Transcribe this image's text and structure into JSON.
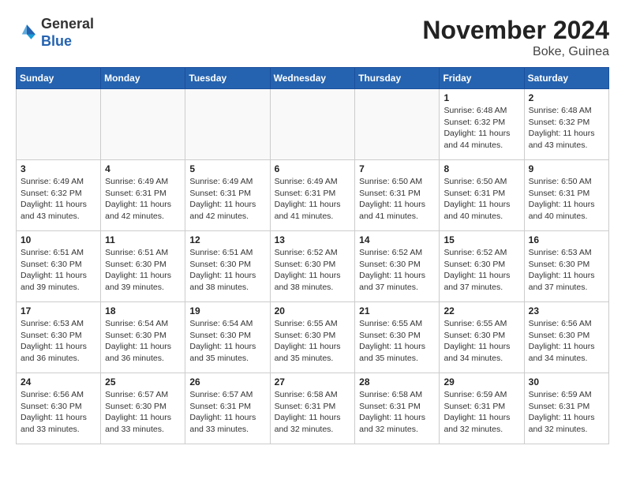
{
  "header": {
    "logo_general": "General",
    "logo_blue": "Blue",
    "month_year": "November 2024",
    "location": "Boke, Guinea"
  },
  "days_of_week": [
    "Sunday",
    "Monday",
    "Tuesday",
    "Wednesday",
    "Thursday",
    "Friday",
    "Saturday"
  ],
  "weeks": [
    [
      {
        "day": "",
        "info": ""
      },
      {
        "day": "",
        "info": ""
      },
      {
        "day": "",
        "info": ""
      },
      {
        "day": "",
        "info": ""
      },
      {
        "day": "",
        "info": ""
      },
      {
        "day": "1",
        "info": "Sunrise: 6:48 AM\nSunset: 6:32 PM\nDaylight: 11 hours and 44 minutes."
      },
      {
        "day": "2",
        "info": "Sunrise: 6:48 AM\nSunset: 6:32 PM\nDaylight: 11 hours and 43 minutes."
      }
    ],
    [
      {
        "day": "3",
        "info": "Sunrise: 6:49 AM\nSunset: 6:32 PM\nDaylight: 11 hours and 43 minutes."
      },
      {
        "day": "4",
        "info": "Sunrise: 6:49 AM\nSunset: 6:31 PM\nDaylight: 11 hours and 42 minutes."
      },
      {
        "day": "5",
        "info": "Sunrise: 6:49 AM\nSunset: 6:31 PM\nDaylight: 11 hours and 42 minutes."
      },
      {
        "day": "6",
        "info": "Sunrise: 6:49 AM\nSunset: 6:31 PM\nDaylight: 11 hours and 41 minutes."
      },
      {
        "day": "7",
        "info": "Sunrise: 6:50 AM\nSunset: 6:31 PM\nDaylight: 11 hours and 41 minutes."
      },
      {
        "day": "8",
        "info": "Sunrise: 6:50 AM\nSunset: 6:31 PM\nDaylight: 11 hours and 40 minutes."
      },
      {
        "day": "9",
        "info": "Sunrise: 6:50 AM\nSunset: 6:31 PM\nDaylight: 11 hours and 40 minutes."
      }
    ],
    [
      {
        "day": "10",
        "info": "Sunrise: 6:51 AM\nSunset: 6:30 PM\nDaylight: 11 hours and 39 minutes."
      },
      {
        "day": "11",
        "info": "Sunrise: 6:51 AM\nSunset: 6:30 PM\nDaylight: 11 hours and 39 minutes."
      },
      {
        "day": "12",
        "info": "Sunrise: 6:51 AM\nSunset: 6:30 PM\nDaylight: 11 hours and 38 minutes."
      },
      {
        "day": "13",
        "info": "Sunrise: 6:52 AM\nSunset: 6:30 PM\nDaylight: 11 hours and 38 minutes."
      },
      {
        "day": "14",
        "info": "Sunrise: 6:52 AM\nSunset: 6:30 PM\nDaylight: 11 hours and 37 minutes."
      },
      {
        "day": "15",
        "info": "Sunrise: 6:52 AM\nSunset: 6:30 PM\nDaylight: 11 hours and 37 minutes."
      },
      {
        "day": "16",
        "info": "Sunrise: 6:53 AM\nSunset: 6:30 PM\nDaylight: 11 hours and 37 minutes."
      }
    ],
    [
      {
        "day": "17",
        "info": "Sunrise: 6:53 AM\nSunset: 6:30 PM\nDaylight: 11 hours and 36 minutes."
      },
      {
        "day": "18",
        "info": "Sunrise: 6:54 AM\nSunset: 6:30 PM\nDaylight: 11 hours and 36 minutes."
      },
      {
        "day": "19",
        "info": "Sunrise: 6:54 AM\nSunset: 6:30 PM\nDaylight: 11 hours and 35 minutes."
      },
      {
        "day": "20",
        "info": "Sunrise: 6:55 AM\nSunset: 6:30 PM\nDaylight: 11 hours and 35 minutes."
      },
      {
        "day": "21",
        "info": "Sunrise: 6:55 AM\nSunset: 6:30 PM\nDaylight: 11 hours and 35 minutes."
      },
      {
        "day": "22",
        "info": "Sunrise: 6:55 AM\nSunset: 6:30 PM\nDaylight: 11 hours and 34 minutes."
      },
      {
        "day": "23",
        "info": "Sunrise: 6:56 AM\nSunset: 6:30 PM\nDaylight: 11 hours and 34 minutes."
      }
    ],
    [
      {
        "day": "24",
        "info": "Sunrise: 6:56 AM\nSunset: 6:30 PM\nDaylight: 11 hours and 33 minutes."
      },
      {
        "day": "25",
        "info": "Sunrise: 6:57 AM\nSunset: 6:30 PM\nDaylight: 11 hours and 33 minutes."
      },
      {
        "day": "26",
        "info": "Sunrise: 6:57 AM\nSunset: 6:31 PM\nDaylight: 11 hours and 33 minutes."
      },
      {
        "day": "27",
        "info": "Sunrise: 6:58 AM\nSunset: 6:31 PM\nDaylight: 11 hours and 32 minutes."
      },
      {
        "day": "28",
        "info": "Sunrise: 6:58 AM\nSunset: 6:31 PM\nDaylight: 11 hours and 32 minutes."
      },
      {
        "day": "29",
        "info": "Sunrise: 6:59 AM\nSunset: 6:31 PM\nDaylight: 11 hours and 32 minutes."
      },
      {
        "day": "30",
        "info": "Sunrise: 6:59 AM\nSunset: 6:31 PM\nDaylight: 11 hours and 32 minutes."
      }
    ]
  ]
}
